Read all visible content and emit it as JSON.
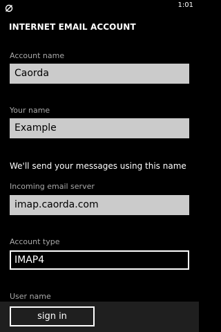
{
  "status_bar": {
    "time": "1:01",
    "signal_icon": "no-signal-icon"
  },
  "page": {
    "title": "INTERNET EMAIL ACCOUNT"
  },
  "form": {
    "account_name": {
      "label": "Account name",
      "value": "Caorda"
    },
    "your_name": {
      "label": "Your name",
      "value": "Example"
    },
    "info_text": "We'll send your messages using this name",
    "incoming_server": {
      "label": "Incoming email server",
      "value": "imap.caorda.com"
    },
    "account_type": {
      "label": "Account type",
      "value": "IMAP4"
    },
    "user_name": {
      "label": "User name"
    }
  },
  "app_bar": {
    "sign_in_label": "sign in"
  }
}
